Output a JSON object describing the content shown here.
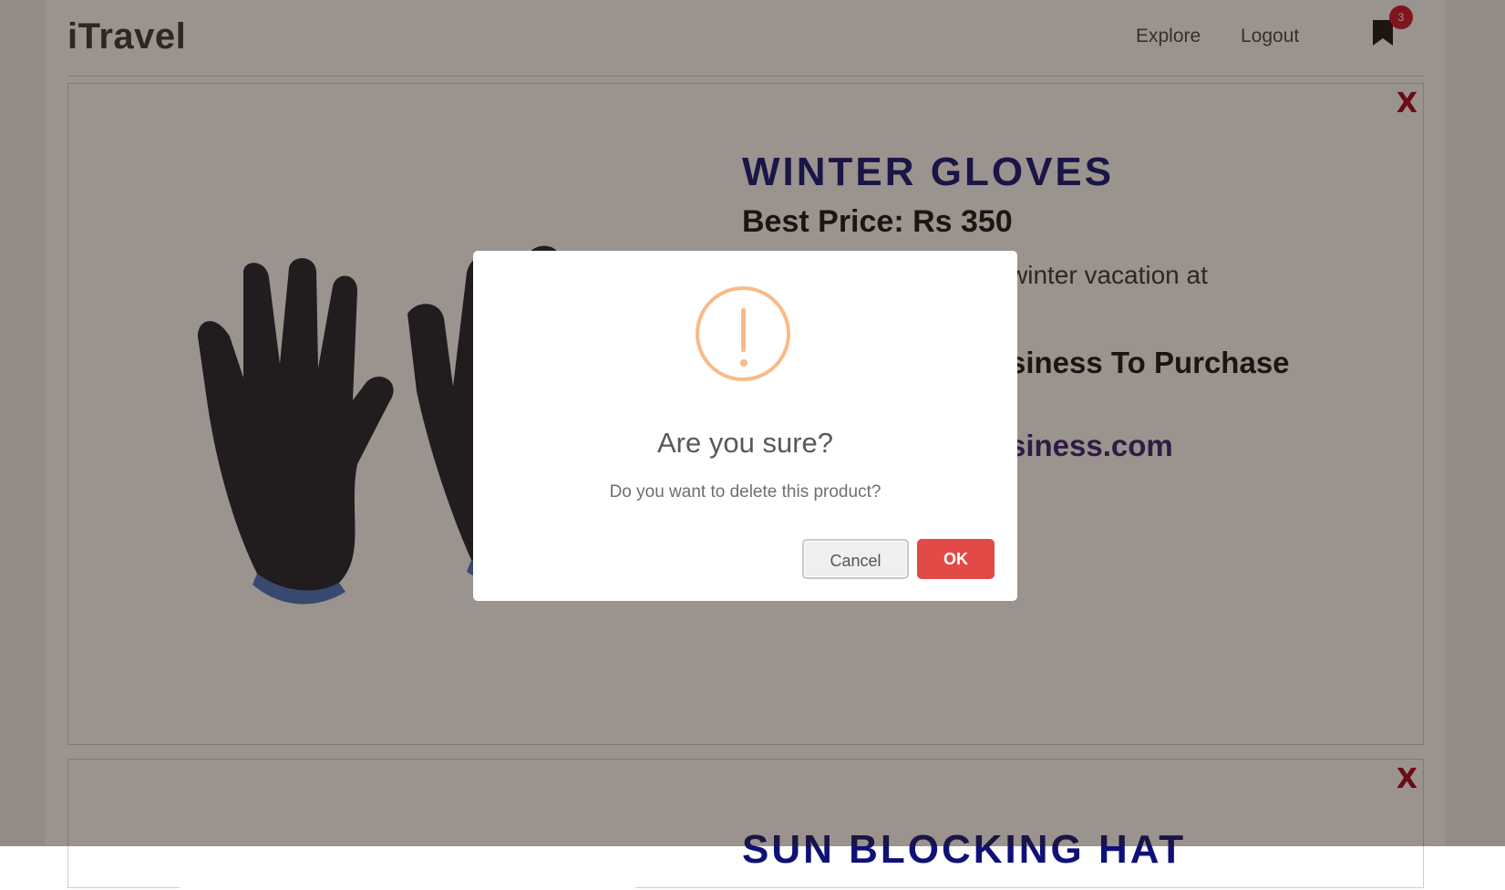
{
  "navbar": {
    "brand": "iTravel",
    "links": [
      "Explore",
      "Logout"
    ],
    "bookmark_count": "3",
    "bookmark_icon": "bookmark-icon"
  },
  "products": [
    {
      "title": "WINTER GLOVES",
      "price": "Best Price: Rs 350",
      "description_visible": "winter vacation at",
      "contact_visible": "siness To Purchase",
      "link_visible": "siness.com",
      "close": "X"
    },
    {
      "title": "SUN BLOCKING HAT",
      "close": "X"
    }
  ],
  "dialog": {
    "icon": "warning-icon",
    "title": "Are you sure?",
    "text": "Do you want to delete this product?",
    "cancel_label": "Cancel",
    "ok_label": "OK"
  },
  "colors": {
    "title": "#0f1178",
    "close": "#a3001c",
    "badge": "#d0102b",
    "ok_button": "#e14a46",
    "warning": "#f8bb86"
  }
}
